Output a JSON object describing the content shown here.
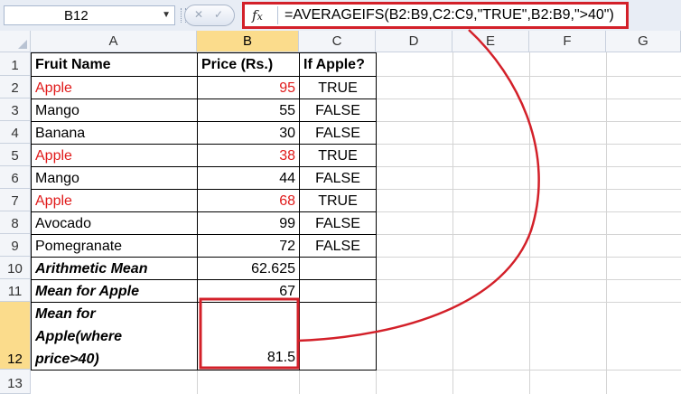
{
  "name_box": "B12",
  "formula": "=AVERAGEIFS(B2:B9,C2:C9,\"TRUE\",B2:B9,\">40\")",
  "fx_icon": "fx-icon",
  "columns": [
    "A",
    "B",
    "C",
    "D",
    "E",
    "F",
    "G"
  ],
  "rows": [
    "1",
    "2",
    "3",
    "4",
    "5",
    "6",
    "7",
    "8",
    "9",
    "10",
    "11",
    "12",
    "13"
  ],
  "headers": {
    "fruit": "Fruit Name",
    "price": "Price (Rs.)",
    "apple": "If Apple?"
  },
  "data": [
    {
      "fruit": "Apple",
      "price": "95",
      "apple": "TRUE",
      "highlight": true
    },
    {
      "fruit": "Mango",
      "price": "55",
      "apple": "FALSE",
      "highlight": false
    },
    {
      "fruit": "Banana",
      "price": "30",
      "apple": "FALSE",
      "highlight": false
    },
    {
      "fruit": "Apple",
      "price": "38",
      "apple": "TRUE",
      "highlight": true
    },
    {
      "fruit": "Mango",
      "price": "44",
      "apple": "FALSE",
      "highlight": false
    },
    {
      "fruit": "Apple",
      "price": "68",
      "apple": "TRUE",
      "highlight": true
    },
    {
      "fruit": "Avocado",
      "price": "99",
      "apple": "FALSE",
      "highlight": false
    },
    {
      "fruit": "Pomegranate",
      "price": "72",
      "apple": "FALSE",
      "highlight": false
    }
  ],
  "summary": {
    "arith_label": "Arithmetic Mean",
    "arith_value": "62.625",
    "apple_label": "Mean for Apple",
    "apple_value": "67",
    "cond_label_1": "Mean for",
    "cond_label_2": "Apple(where",
    "cond_label_3": "price>40)",
    "cond_value": "81.5"
  },
  "colors": {
    "highlight_text": "#e01b1b",
    "annotation": "#d32029",
    "selected_header": "#fbdc8c"
  }
}
